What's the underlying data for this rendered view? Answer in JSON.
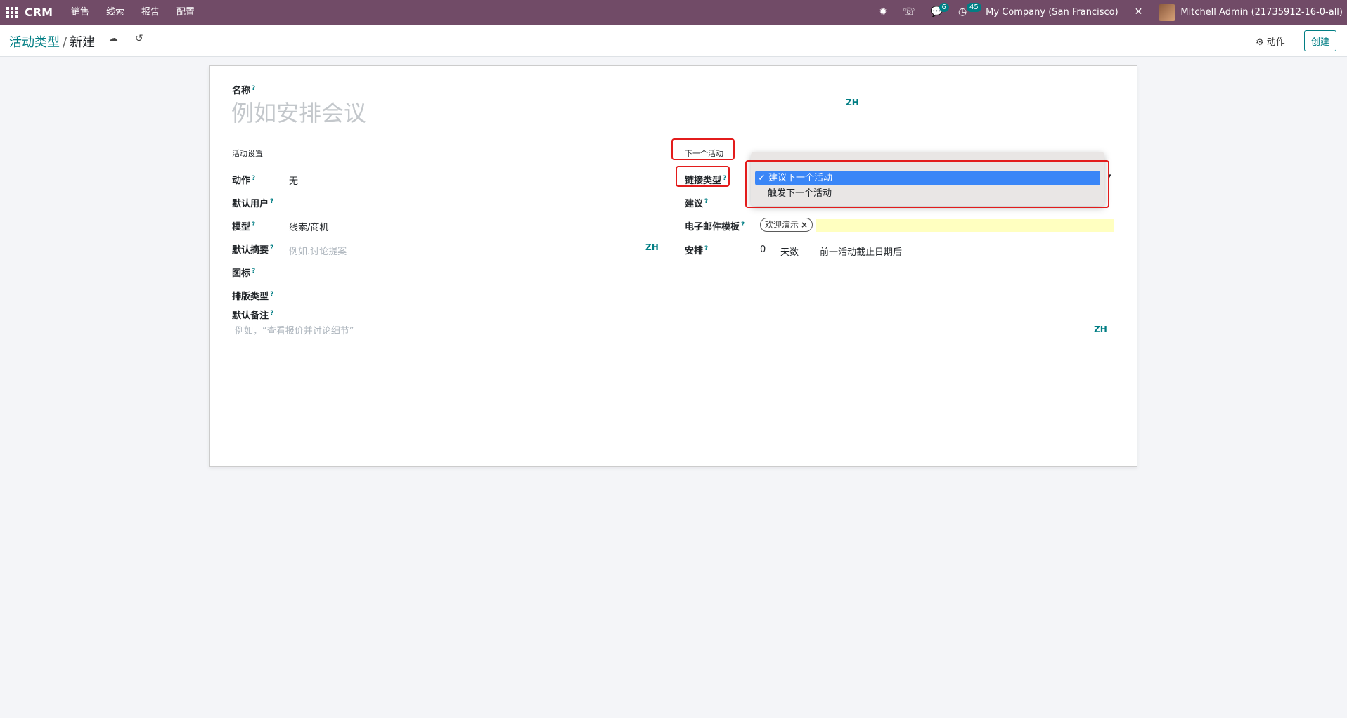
{
  "navbar": {
    "brand": "CRM",
    "menu": [
      "销售",
      "线索",
      "报告",
      "配置"
    ],
    "messages_count": "6",
    "activities_count": "45",
    "company": "My Company (San Francisco)",
    "user": "Mitchell Admin (21735912-16-0-all)"
  },
  "control_panel": {
    "breadcrumb_parent": "活动类型",
    "breadcrumb_separator": "/",
    "breadcrumb_current": "新建",
    "action_label": "动作",
    "create_label": "创建"
  },
  "form": {
    "name_label": "名称",
    "name_placeholder": "例如安排会议",
    "lang_code": "ZH",
    "help_mark": "?",
    "left_section_title": "活动设置",
    "right_section_title": "下一个活动",
    "fields_left": {
      "action_label": "动作",
      "action_value": "无",
      "default_user_label": "默认用户",
      "model_label": "模型",
      "model_value": "线索/商机",
      "default_summary_label": "默认摘要",
      "default_summary_placeholder": "例如.讨论提案",
      "icon_label": "图标",
      "decoration_label": "排版类型",
      "default_note_label": "默认备注",
      "default_note_placeholder": "例如，“查看报价并讨论细节”"
    },
    "fields_right": {
      "chaining_type_label": "链接类型",
      "suggest_label": "建议",
      "email_template_label": "电子邮件模板",
      "email_template_tag": "欢迎演示",
      "schedule_label": "安排",
      "schedule_delay": "0",
      "schedule_unit": "天数",
      "schedule_from": "前一活动截止日期后"
    },
    "chaining_dropdown": {
      "options": [
        "建议下一个活动",
        "触发下一个活动"
      ],
      "selected_index": 0,
      "check_mark": "✓"
    }
  },
  "colors": {
    "navbar": "#714b67",
    "accent": "#017e84",
    "highlight": "#e31c1c",
    "dropdown_selected": "#3a86f7"
  }
}
